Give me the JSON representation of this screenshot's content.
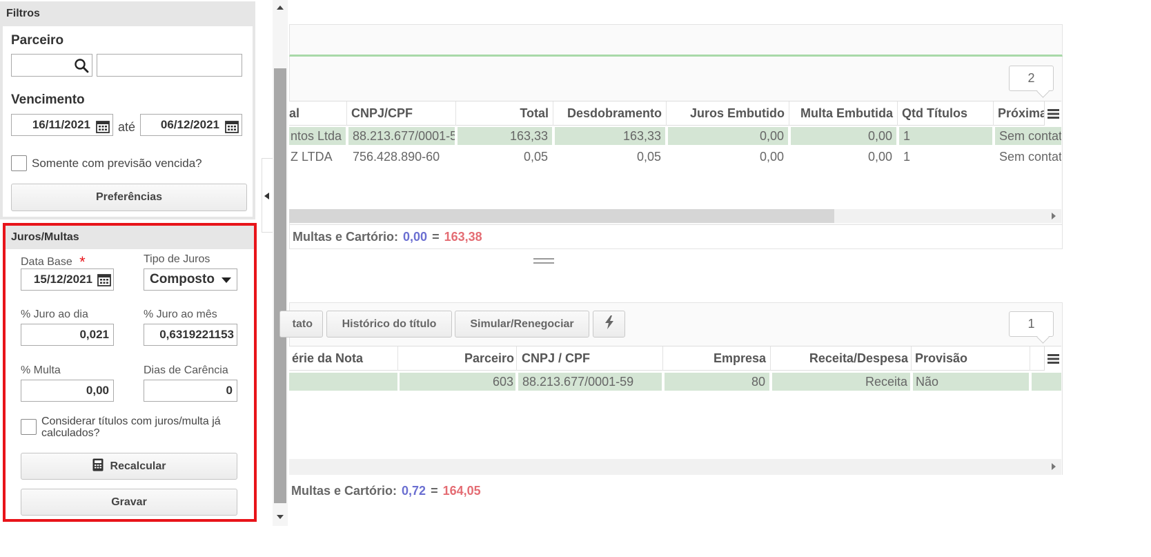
{
  "filters": {
    "title": "Filtros",
    "parceiro_label": "Parceiro",
    "parceiro_code": "",
    "parceiro_name": "",
    "vencimento_label": "Vencimento",
    "date_from": "16/11/2021",
    "ate_label": "até",
    "date_to": "06/12/2021",
    "previsao_label": "Somente com previsão vencida?",
    "preferencias_label": "Preferências"
  },
  "juros": {
    "title": "Juros/Multas",
    "data_base_label": "Data Base",
    "required_mark": "*",
    "data_base_value": "15/12/2021",
    "tipo_juros_label": "Tipo de Juros",
    "tipo_juros_value": "Composto",
    "juro_dia_label": "% Juro ao dia",
    "juro_dia_value": "0,021",
    "juro_mes_label": "% Juro ao mês",
    "juro_mes_value": "0,6319221153",
    "multa_label": "% Multa",
    "multa_value": "0,00",
    "carencia_label": "Dias de Carência",
    "carencia_value": "0",
    "considerar_label": "Considerar títulos com juros/multa já calculados?",
    "recalcular_label": "Recalcular",
    "gravar_label": "Gravar"
  },
  "grid1": {
    "badge": "2",
    "columns": [
      "al",
      "CNPJ/CPF",
      "Total",
      "Desdobramento",
      "Juros Embutido",
      "Multa Embutida",
      "Qtd Títulos",
      "Próxima"
    ],
    "rows": [
      [
        "ntos Ltda",
        "88.213.677/0001-5",
        "163,33",
        "163,33",
        "0,00",
        "0,00",
        "1",
        "Sem contato"
      ],
      [
        "Z LTDA",
        "756.428.890-60",
        "0,05",
        "0,05",
        "0,00",
        "0,00",
        "1",
        "Sem contato"
      ]
    ],
    "footer_label": "Multas e Cartório:",
    "footer_value1": "0,00",
    "footer_eq": "=",
    "footer_value2": "163,38"
  },
  "toolbar": {
    "contato_label": "tato",
    "historico_label": "Histórico do título",
    "simular_label": "Simular/Renegociar"
  },
  "grid2": {
    "badge": "1",
    "columns": [
      "érie da Nota",
      "Parceiro",
      "CNPJ / CPF",
      "Empresa",
      "Receita/Despesa",
      "Provisão"
    ],
    "rows": [
      [
        "",
        "603",
        "88.213.677/0001-59",
        "80",
        "Receita",
        "Não"
      ]
    ],
    "footer_label": "Multas e Cartório:",
    "footer_value1": "0,72",
    "footer_eq": "=",
    "footer_value2": "164,05"
  },
  "colors": {
    "highlight_border": "#e8141a",
    "row_highlight": "#d4e5d4",
    "value_blue": "#6b6fd1",
    "value_red": "#e46c73",
    "tab_line": "#a8d9a8"
  }
}
